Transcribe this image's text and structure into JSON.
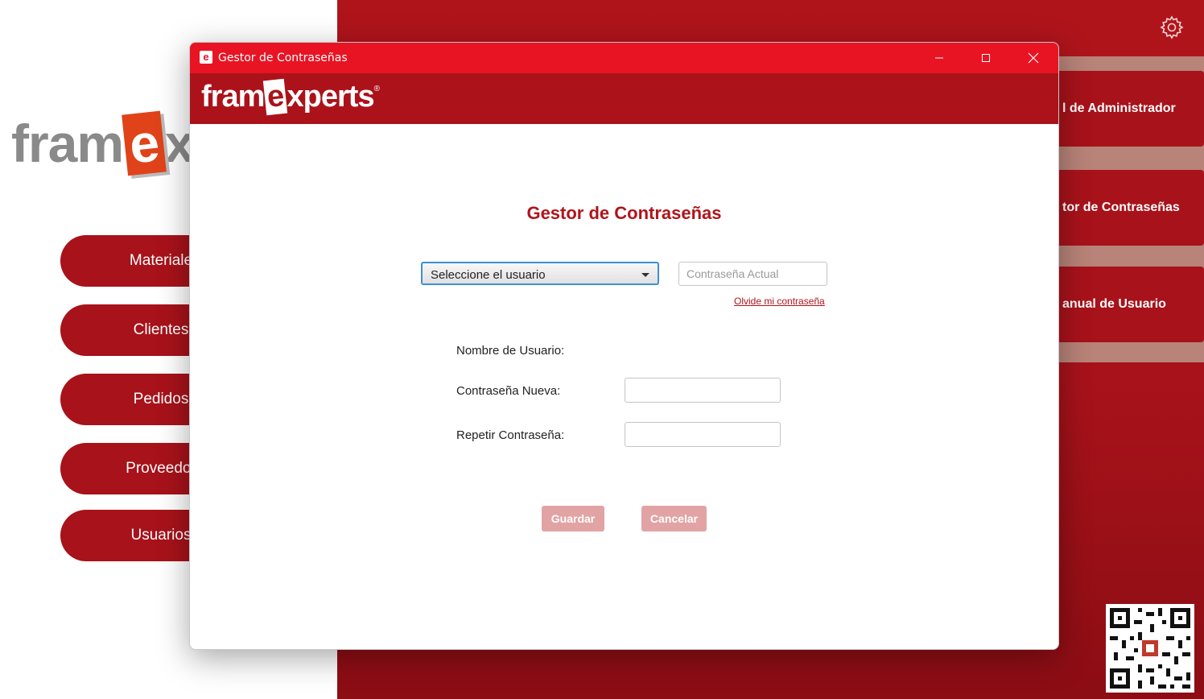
{
  "background": {
    "logo": {
      "text_left": "fram",
      "text_e": "e",
      "text_right": "x"
    },
    "side_menu": [
      "Materiale",
      "Clientes",
      "Pedidos",
      "Proveedor",
      "Usuarios"
    ],
    "right_menu": [
      "l de Administrador",
      "tor de Contraseñas",
      "anual de Usuario"
    ]
  },
  "dialog": {
    "window_title": "Gestor de Contraseñas",
    "app_icon_letter": "e",
    "logo": {
      "left": "fram",
      "e": "e",
      "right": "xperts",
      "reg": "®"
    },
    "heading": "Gestor de Contraseñas",
    "user_select": {
      "selected": "Seleccione el usuario"
    },
    "current_password": {
      "placeholder": "Contraseña Actual"
    },
    "forgot_link": "Olvide mi contraseña",
    "username_label": "Nombre de Usuario:",
    "new_password_label": "Contraseña Nueva:",
    "repeat_password_label": "Repetir Contraseña:",
    "save_button": "Guardar",
    "cancel_button": "Cancelar"
  },
  "colors": {
    "brand_red": "#b0141b",
    "titlebar_red": "#e81424",
    "disabled_button": "#e2a3a5"
  }
}
